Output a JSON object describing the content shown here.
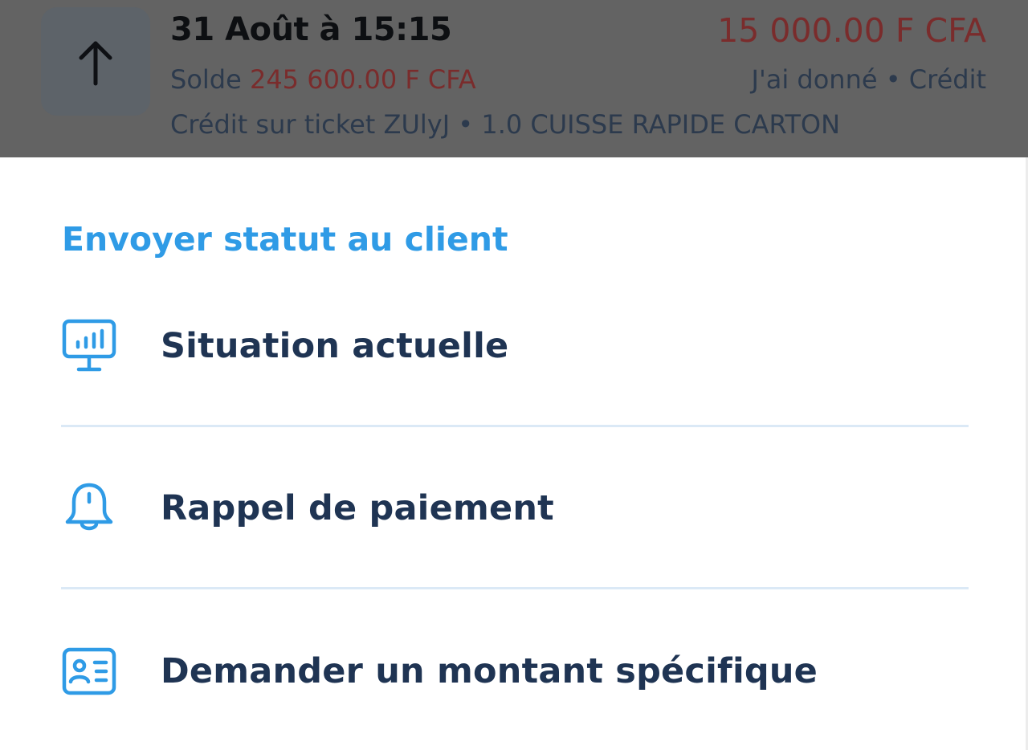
{
  "transaction": {
    "date": "31 Août à 15:15",
    "amount": "15 000.00 F CFA",
    "balance_label": "Solde ",
    "balance_value": "245 600.00 F CFA",
    "kind": "J'ai donné • Crédit",
    "description": "Crédit sur ticket ZUlyJ • 1.0 CUISSE RAPIDE CARTON",
    "icon": "arrow-up-icon"
  },
  "sheet": {
    "title": "Envoyer statut au client",
    "options": [
      {
        "label": "Situation actuelle",
        "icon": "monitor-chart-icon"
      },
      {
        "label": "Rappel de paiement",
        "icon": "bell-icon"
      },
      {
        "label": "Demander un montant spécifique",
        "icon": "id-card-icon"
      }
    ]
  },
  "colors": {
    "accent": "#2f9be6",
    "label": "#1f3453",
    "overlay": "#636363",
    "amount_red": "#7a2c2c",
    "divider": "#dbe9f6"
  }
}
